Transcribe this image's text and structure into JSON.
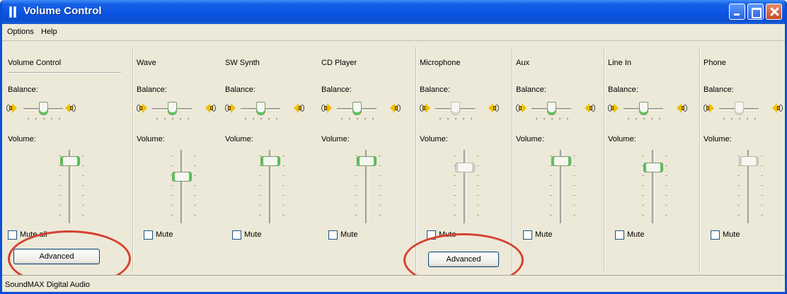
{
  "window": {
    "title": "Volume Control"
  },
  "menu": {
    "items": [
      "Options",
      "Help"
    ]
  },
  "master": {
    "name": "Volume Control",
    "balance_label": "Balance:",
    "volume_label": "Volume:",
    "mute_label": "Mute all",
    "advanced_label": "Advanced",
    "balance": 0.5,
    "volume": 0.9
  },
  "channels": [
    {
      "name": "Wave",
      "balance_label": "Balance:",
      "volume_label": "Volume:",
      "mute_label": "Mute",
      "balance": 0.5,
      "volume": 0.65,
      "enabled": true
    },
    {
      "name": "SW Synth",
      "balance_label": "Balance:",
      "volume_label": "Volume:",
      "mute_label": "Mute",
      "balance": 0.5,
      "volume": 0.9,
      "enabled": true
    },
    {
      "name": "CD Player",
      "balance_label": "Balance:",
      "volume_label": "Volume:",
      "mute_label": "Mute",
      "balance": 0.5,
      "volume": 0.9,
      "enabled": true
    },
    {
      "name": "Microphone",
      "balance_label": "Balance:",
      "volume_label": "Volume:",
      "mute_label": "Mute",
      "advanced_label": "Advanced",
      "balance": 0.5,
      "volume": 0.8,
      "enabled": false
    },
    {
      "name": "Aux",
      "balance_label": "Balance:",
      "volume_label": "Volume:",
      "mute_label": "Mute",
      "balance": 0.5,
      "volume": 0.9,
      "enabled": true
    },
    {
      "name": "Line In",
      "balance_label": "Balance:",
      "volume_label": "Volume:",
      "mute_label": "Mute",
      "balance": 0.5,
      "volume": 0.8,
      "enabled": true
    },
    {
      "name": "Phone",
      "balance_label": "Balance:",
      "volume_label": "Volume:",
      "mute_label": "Mute",
      "balance": 0.5,
      "volume": 0.9,
      "enabled": false
    }
  ],
  "status": {
    "text": "SoundMAX Digital Audio"
  },
  "colors": {
    "titlebar": "#0a54e2",
    "face": "#ece9d8",
    "annotation": "#d64030",
    "thumb_accent": "#52c65a"
  }
}
